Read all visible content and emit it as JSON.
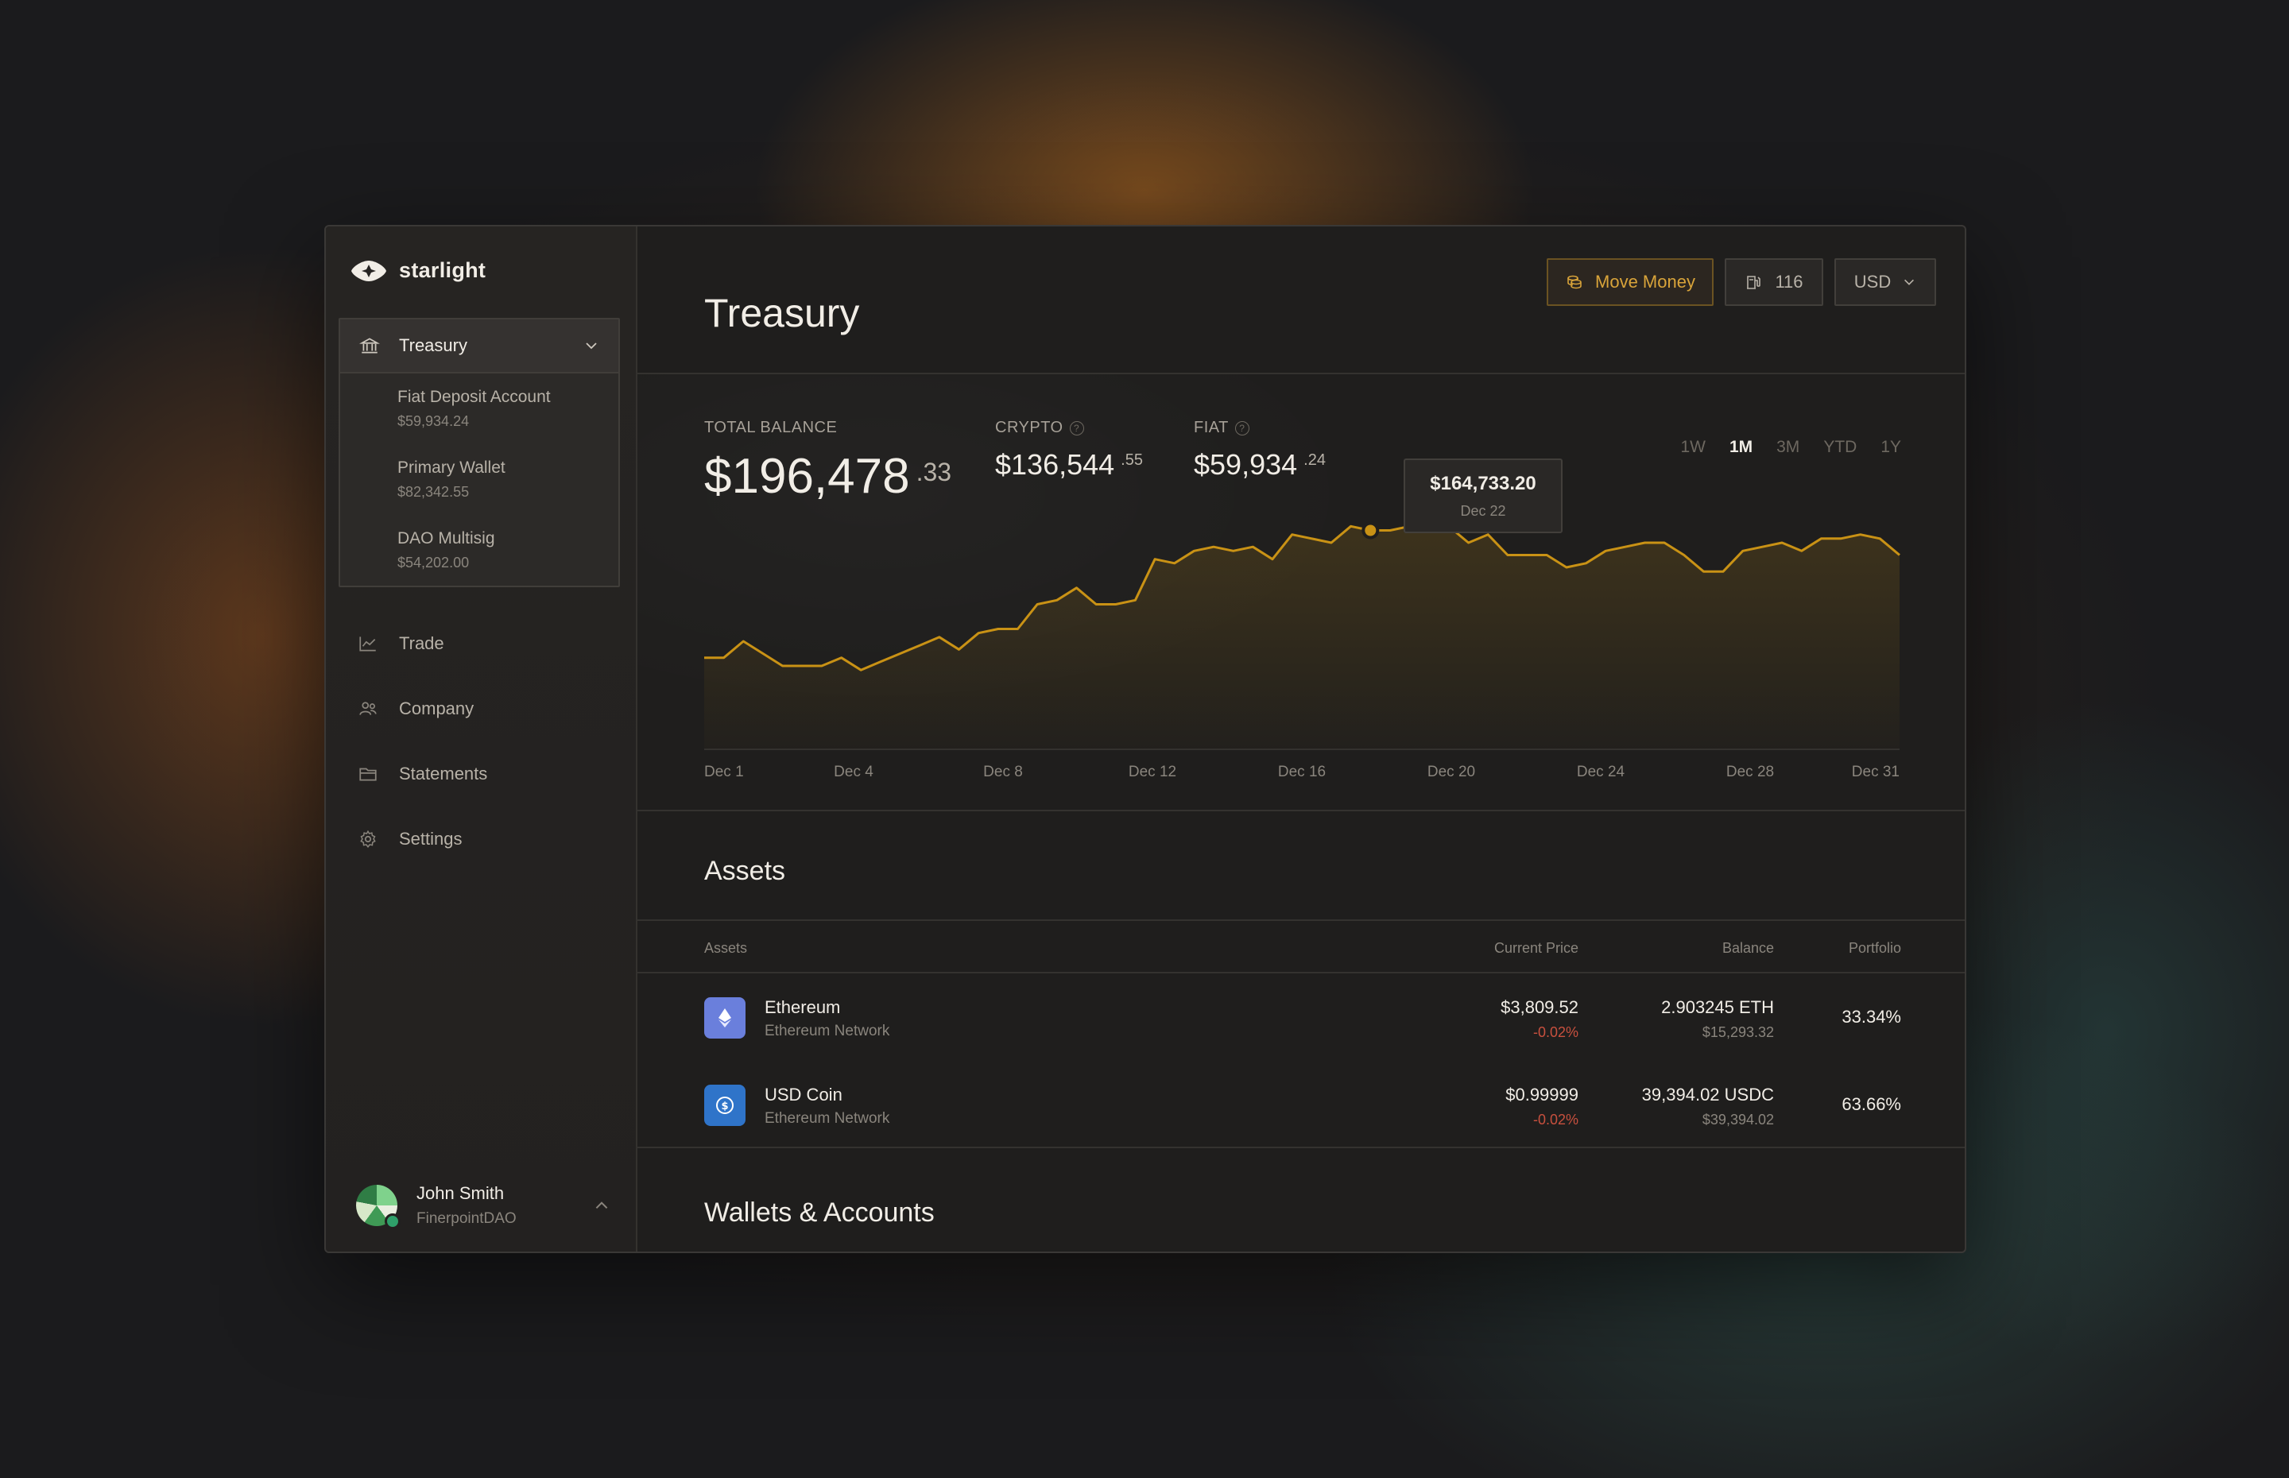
{
  "app": {
    "name": "starlight"
  },
  "sidebar": {
    "group": {
      "label": "Treasury",
      "items": [
        {
          "label": "Fiat Deposit Account",
          "value": "$59,934.24"
        },
        {
          "label": "Primary Wallet",
          "value": "$82,342.55"
        },
        {
          "label": "DAO Multisig",
          "value": "$54,202.00"
        }
      ]
    },
    "items": [
      {
        "label": "Trade",
        "icon": "chart-icon"
      },
      {
        "label": "Company",
        "icon": "users-icon"
      },
      {
        "label": "Statements",
        "icon": "folder-icon"
      },
      {
        "label": "Settings",
        "icon": "gear-icon"
      }
    ],
    "user": {
      "name": "John Smith",
      "org": "FinerpointDAO"
    }
  },
  "header": {
    "title": "Treasury",
    "move_money": "Move Money",
    "gas": "116",
    "currency": "USD"
  },
  "stats": {
    "total": {
      "label": "TOTAL BALANCE",
      "whole": "$196,478",
      "cents": ".33"
    },
    "crypto": {
      "label": "CRYPTO",
      "whole": "$136,544",
      "cents": ".55"
    },
    "fiat": {
      "label": "FIAT",
      "whole": "$59,934",
      "cents": ".24"
    }
  },
  "ranges": [
    "1W",
    "1M",
    "3M",
    "YTD",
    "1Y"
  ],
  "active_range": "1M",
  "tooltip": {
    "amount": "$164,733.20",
    "date": "Dec 22"
  },
  "chart_data": {
    "type": "area",
    "x_labels": [
      "Dec 1",
      "Dec 4",
      "Dec 8",
      "Dec 12",
      "Dec 16",
      "Dec 20",
      "Dec 24",
      "Dec 28",
      "Dec 31"
    ],
    "values": [
      120,
      120,
      124,
      121,
      118,
      118,
      118,
      120,
      117,
      119,
      121,
      123,
      125,
      122,
      126,
      127,
      127,
      133,
      134,
      137,
      133,
      133,
      134,
      144,
      143,
      146,
      147,
      146,
      147,
      144,
      150,
      149,
      148,
      152,
      151,
      151,
      152,
      153,
      152,
      148,
      150,
      145,
      145,
      145,
      142,
      143,
      146,
      147,
      148,
      148,
      145,
      141,
      141,
      146,
      147,
      148,
      146,
      149,
      149,
      150,
      149,
      145
    ],
    "ylim": [
      100,
      160
    ],
    "highlight_index": 34,
    "color": "#c99215"
  },
  "assets": {
    "title": "Assets",
    "columns": [
      "Assets",
      "Current Price",
      "Balance",
      "Portfolio"
    ],
    "rows": [
      {
        "name": "Ethereum",
        "network": "Ethereum Network",
        "price": "$3,809.52",
        "change": "-0.02%",
        "balance": "2.903245 ETH",
        "balance_usd": "$15,293.32",
        "portfolio": "33.34%",
        "icon": "ethereum-icon",
        "color": "#6a7fdc"
      },
      {
        "name": "USD Coin",
        "network": "Ethereum Network",
        "price": "$0.99999",
        "change": "-0.02%",
        "balance": "39,394.02 USDC",
        "balance_usd": "$39,394.02",
        "portfolio": "63.66%",
        "icon": "usdc-icon",
        "color": "#2f74c9"
      }
    ]
  },
  "wallets": {
    "title": "Wallets & Accounts"
  }
}
